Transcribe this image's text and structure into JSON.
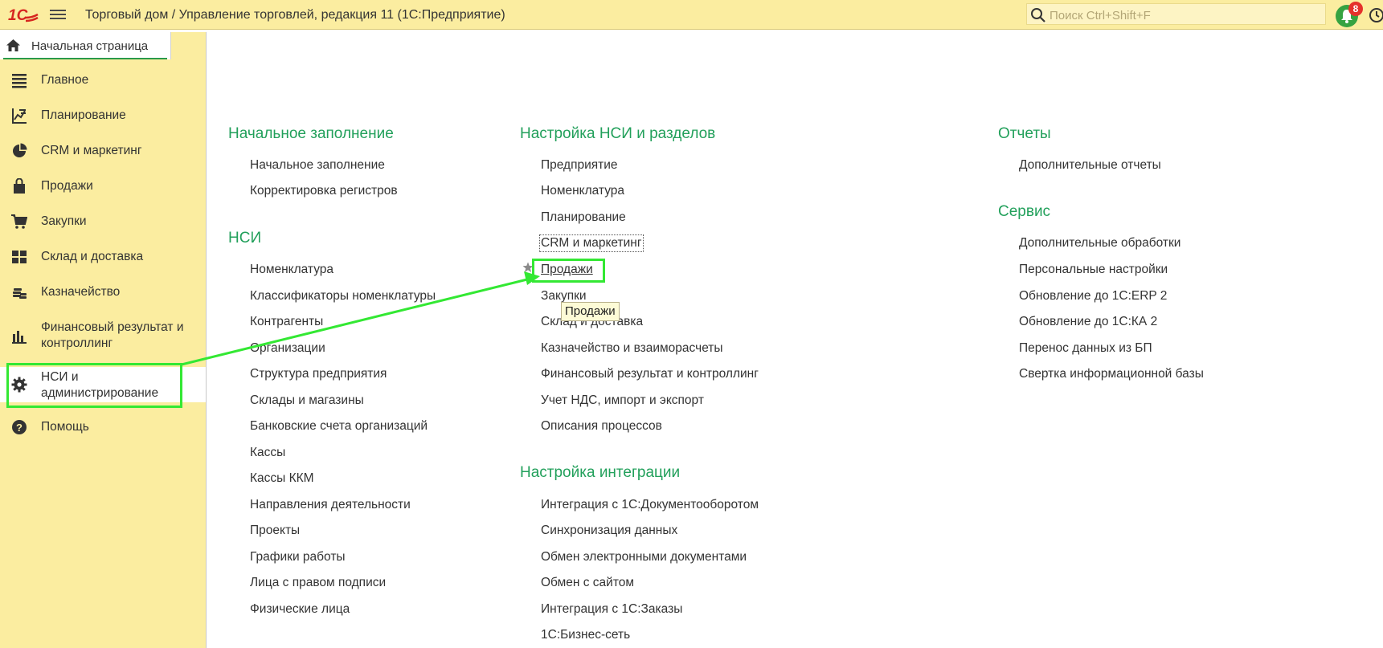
{
  "topbar": {
    "logo_text": "1С",
    "title": "Торговый дом / Управление торговлей, редакция 11  (1С:Предприятие)",
    "search_placeholder": "Поиск Ctrl+Shift+F",
    "notifications_count": "8",
    "accent_color": "#fbeda0",
    "notify_color": "#36a341"
  },
  "home_tab": {
    "label": "Начальная страница"
  },
  "sidebar": {
    "items": [
      {
        "label": "Главное",
        "icon": "list-icon"
      },
      {
        "label": "Планирование",
        "icon": "planning-chart-icon"
      },
      {
        "label": "CRM и маркетинг",
        "icon": "pie-chart-icon"
      },
      {
        "label": "Продажи",
        "icon": "shopping-bag-icon"
      },
      {
        "label": "Закупки",
        "icon": "cart-icon"
      },
      {
        "label": "Склад и доставка",
        "icon": "warehouse-grid-icon"
      },
      {
        "label": "Казначейство",
        "icon": "coins-icon"
      },
      {
        "label": "Финансовый результат и контроллинг",
        "icon": "bar-chart-icon"
      },
      {
        "label": "НСИ и администрирование",
        "icon": "gear-icon",
        "selected": true
      },
      {
        "label": "Помощь",
        "icon": "help-icon"
      }
    ]
  },
  "main": {
    "col1": {
      "sections": [
        {
          "title": "Начальное заполнение",
          "links": [
            "Начальное заполнение",
            "Корректировка регистров"
          ]
        },
        {
          "title": "НСИ",
          "links": [
            "Номенклатура",
            "Классификаторы номенклатуры",
            "Контрагенты",
            "Организации",
            "Структура предприятия",
            "Склады и магазины",
            "Банковские счета организаций",
            "Кассы",
            "Кассы ККМ",
            "Направления деятельности",
            "Проекты",
            "Графики работы",
            "Лица с правом подписи",
            "Физические лица"
          ]
        }
      ]
    },
    "col2": {
      "sections": [
        {
          "title": "Настройка НСИ и разделов",
          "links": [
            "Предприятие",
            "Номенклатура",
            "Планирование",
            "CRM и маркетинг",
            "Продажи",
            "Закупки",
            "Склад и доставка",
            "Казначейство и взаиморасчеты",
            "Финансовый результат и контроллинг",
            "Учет НДС, импорт и экспорт",
            "Описания процессов"
          ]
        },
        {
          "title": "Настройка интеграции",
          "links": [
            "Интеграция с 1С:Документооборотом",
            "Синхронизация данных",
            "Обмен электронными документами",
            "Обмен с сайтом",
            "Интеграция с 1С:Заказы",
            "1С:Бизнес-сеть"
          ]
        }
      ]
    },
    "col3": {
      "sections": [
        {
          "title": "Отчеты",
          "links": [
            "Дополнительные отчеты"
          ]
        },
        {
          "title": "Сервис",
          "links": [
            "Дополнительные обработки",
            "Персональные настройки",
            "Обновление до 1С:ERP 2",
            "Обновление до 1С:КА 2",
            "Перенос данных из БП",
            "Свертка информационной базы"
          ]
        }
      ]
    },
    "tooltip": "Продажи",
    "section_color": "#22a05b"
  },
  "annotation": {
    "color": "#33e833"
  }
}
